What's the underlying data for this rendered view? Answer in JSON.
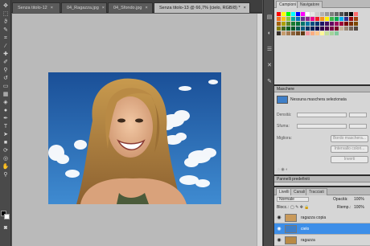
{
  "tabs": [
    {
      "label": "Senza titolo-12",
      "close": "×",
      "active": false
    },
    {
      "label": "04_Ragazza.jpg",
      "close": "×",
      "active": false
    },
    {
      "label": "04_Sfondo.jpg",
      "close": "×",
      "active": false
    },
    {
      "label": "Senza titolo-13 @ 66,7% (cielo, RGB/8) *",
      "close": "×",
      "active": true
    }
  ],
  "swatches_panel": {
    "tabs": [
      "Campioni",
      "Navigatore"
    ],
    "colors": [
      "#ff0000",
      "#ffff00",
      "#00ff00",
      "#00ffff",
      "#0000ff",
      "#ff00ff",
      "#ffffff",
      "#e6e6e6",
      "#cccccc",
      "#b3b3b3",
      "#999999",
      "#808080",
      "#666666",
      "#4d4d4d",
      "#333333",
      "#000000",
      "#ff6b6b",
      "#f36f21",
      "#ffc20e",
      "#8dc63f",
      "#00a99d",
      "#0072bc",
      "#662d91",
      "#92278f",
      "#ec008c",
      "#ed1c24",
      "#f7941d",
      "#fff200",
      "#39b54a",
      "#00a651",
      "#00aeef",
      "#2e3192",
      "#9e0b0f",
      "#a0410d",
      "#a36209",
      "#aba000",
      "#598527",
      "#1a7b30",
      "#007236",
      "#00746b",
      "#0076a3",
      "#004b80",
      "#003471",
      "#1b1464",
      "#440e62",
      "#630460",
      "#9e005d",
      "#9e0039",
      "#790000",
      "#7b2e00",
      "#7d4900",
      "#827b00",
      "#406618",
      "#005e20",
      "#005826",
      "#005952",
      "#005b7f",
      "#003663",
      "#002157",
      "#0d004c",
      "#32004b",
      "#4b0049",
      "#7b0046",
      "#7a0026",
      "#c7b299",
      "#998675",
      "#736357",
      "#534741",
      "#37302a",
      "#c69c6d",
      "#a67c52",
      "#8c6239",
      "#754c24",
      "#603913",
      "#f5989d",
      "#f9ad81",
      "#fdc68a",
      "#fff799",
      "#c4df9b",
      "#a3d39c",
      "#82ca9c"
    ]
  },
  "masks_panel": {
    "title": "Maschere",
    "status": "Nessuna maschera selezionata",
    "density_label": "Densità:",
    "feather_label": "Sfuma:",
    "refine_label": "Migliora:",
    "btn_edge": "Bordo maschera...",
    "btn_color_range": "Intervallo colori...",
    "btn_invert": "Inverti"
  },
  "presets_panel": {
    "title": "Pannelli predefiniti"
  },
  "layers_panel": {
    "tabs": [
      "Livelli",
      "Canali",
      "Tracciati"
    ],
    "blend_mode": "Normale",
    "opacity_label": "Opacità:",
    "opacity_value": "100%",
    "lock_label": "Blocc.:",
    "fill_label": "Riemp.:",
    "fill_value": "100%",
    "layers": [
      {
        "name": "ragazza copia",
        "selected": false
      },
      {
        "name": "cielo",
        "selected": true
      },
      {
        "name": "ragazza",
        "selected": false
      }
    ]
  },
  "icons": {
    "eye": "eye-icon",
    "chain": "link-icon"
  }
}
